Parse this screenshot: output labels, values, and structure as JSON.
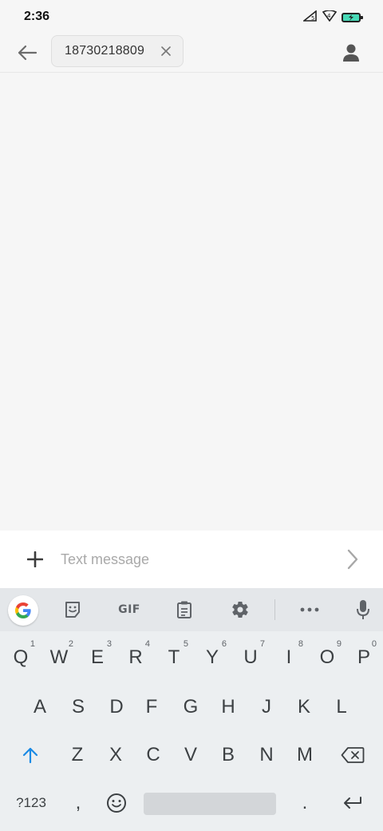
{
  "status_bar": {
    "time": "2:36"
  },
  "header": {
    "recipient": "18730218809"
  },
  "compose": {
    "placeholder": "Text message"
  },
  "keyboard": {
    "toolbar": {
      "gif_label": "GIF"
    },
    "row1": [
      {
        "k": "Q",
        "n": "1"
      },
      {
        "k": "W",
        "n": "2"
      },
      {
        "k": "E",
        "n": "3"
      },
      {
        "k": "R",
        "n": "4"
      },
      {
        "k": "T",
        "n": "5"
      },
      {
        "k": "Y",
        "n": "6"
      },
      {
        "k": "U",
        "n": "7"
      },
      {
        "k": "I",
        "n": "8"
      },
      {
        "k": "O",
        "n": "9"
      },
      {
        "k": "P",
        "n": "0"
      }
    ],
    "row2": [
      "A",
      "S",
      "D",
      "F",
      "G",
      "H",
      "J",
      "K",
      "L"
    ],
    "row3": [
      "Z",
      "X",
      "C",
      "V",
      "B",
      "N",
      "M"
    ],
    "row4": {
      "symbols": "?123",
      "comma": ",",
      "period": "."
    }
  }
}
